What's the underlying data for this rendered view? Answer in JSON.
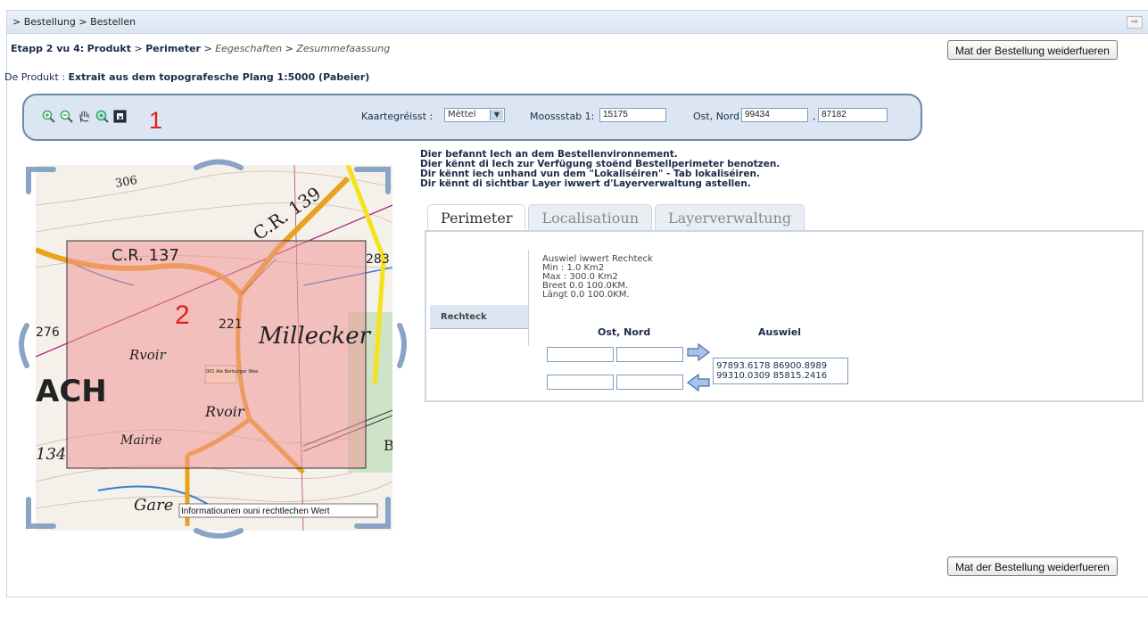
{
  "breadcrumb": "> Bestellung > Bestellen",
  "continue_label": "Mat der Bestellung weiderfueren",
  "steps": {
    "prefix": "Etapp 2 vu 4:",
    "step_product": "Produkt",
    "sep": ">",
    "step_perimeter": "Perimeter",
    "step_properties": "Eegeschaften",
    "step_summary": "Zesummefaassung"
  },
  "product": {
    "label": "De Produkt :",
    "name": "Extrait aus dem topografesche Plang 1:5000 (Pabeier)"
  },
  "toolbar": {
    "marker1": "1",
    "map_size_label": "Kaartegréisst :",
    "map_size_value": "Mëttel",
    "scale_label": "Moossstab 1:",
    "scale_value": "15175",
    "coord_label": "Ost, Nord",
    "coord_east": "99434",
    "coord_north": "87182",
    "comma": ","
  },
  "map": {
    "marker2": "2",
    "labels": [
      "306",
      "C.R. 139",
      "C.R. 137",
      "283",
      "276",
      "221",
      "Millecker",
      "Rvoir",
      "ACH",
      "Rvoir",
      "Mairie",
      "134",
      "B",
      "Gare",
      "001 Ale Berburger Wee"
    ],
    "disclaimer": "Informatiounen ouni rechtlechen Wert"
  },
  "info_lines": [
    "Dier befannt Iech an dem Bestellenvironnement.",
    "Dier kënnt di Iech zur Verfügung stoënd Bestellperimeter benotzen.",
    "Dir kënnt iech unhand vun dem \"Lokaliséiren\" - Tab lokaliséiren.",
    "Dir kënnt di sichtbar Layer iwwert d'Layerverwaltung astellen."
  ],
  "tabs": [
    "Perimeter",
    "Localisatioun",
    "Layerverwaltung"
  ],
  "perimeter": {
    "type_label": "Rechteck",
    "select_lines": [
      "Auswiel iwwert Rechteck",
      "Min : 1.0 Km2",
      "Max : 300.0 Km2",
      "Breet 0.0 100.0KM.",
      "Längt 0.0 100.0KM."
    ],
    "col_coords": "Ost, Nord",
    "col_selection": "Auswiel",
    "results": [
      "97893.6178 86900.8989",
      "99310.0309 85815.2416"
    ]
  }
}
